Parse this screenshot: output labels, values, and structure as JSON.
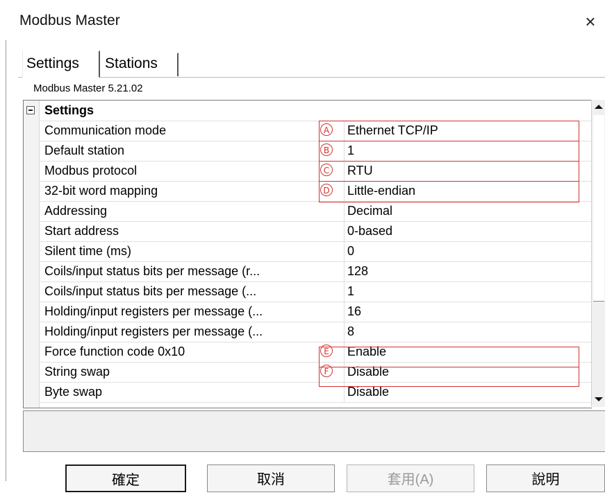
{
  "window": {
    "title": "Modbus Master",
    "close_glyph": "×"
  },
  "tabs": [
    {
      "label": "Settings"
    },
    {
      "label": "Stations"
    }
  ],
  "version_label": "Modbus Master 5.21.02",
  "group": {
    "label": "Settings",
    "expander_glyph": "minus-box-icon"
  },
  "properties": [
    {
      "name": "Communication mode",
      "value": "Ethernet TCP/IP",
      "marker": "A"
    },
    {
      "name": "Default station",
      "value": "1",
      "marker": "B"
    },
    {
      "name": "Modbus protocol",
      "value": "RTU",
      "marker": "C"
    },
    {
      "name": "32-bit word mapping",
      "value": "Little-endian",
      "marker": "D"
    },
    {
      "name": "Addressing",
      "value": "Decimal",
      "marker": ""
    },
    {
      "name": "Start address",
      "value": "0-based",
      "marker": ""
    },
    {
      "name": "Silent time (ms)",
      "value": "0",
      "marker": ""
    },
    {
      "name": "Coils/input status bits per message (r...",
      "value": "128",
      "marker": ""
    },
    {
      "name": "Coils/input status bits per message (...",
      "value": "1",
      "marker": ""
    },
    {
      "name": "Holding/input registers per message (...",
      "value": "16",
      "marker": ""
    },
    {
      "name": "Holding/input registers per message (...",
      "value": "8",
      "marker": ""
    },
    {
      "name": "Force function code 0x10",
      "value": "Enable",
      "marker": "E"
    },
    {
      "name": "String swap",
      "value": "Disable",
      "marker": "F"
    },
    {
      "name": "Byte swap",
      "value": "Disable",
      "marker": ""
    }
  ],
  "buttons": {
    "ok": "確定",
    "cancel": "取消",
    "apply": "套用(A)",
    "help": "說明"
  },
  "colors": {
    "annotation_red": "#d0332f"
  }
}
